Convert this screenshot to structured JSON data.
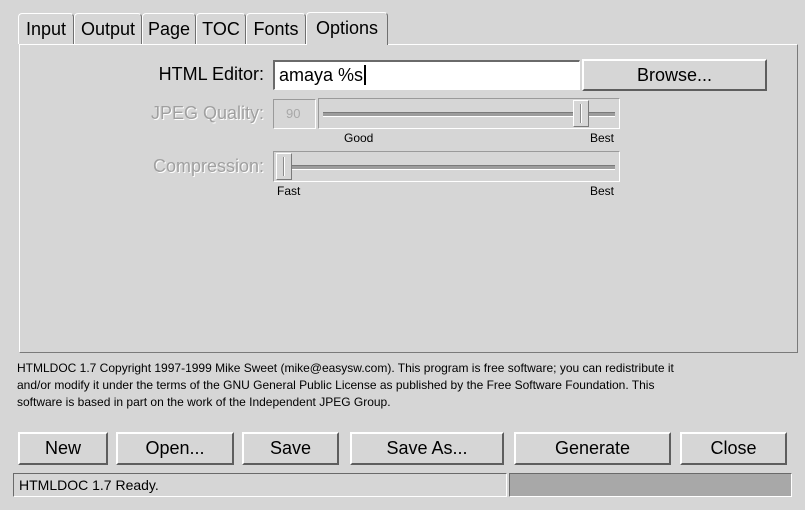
{
  "tabs": [
    {
      "label": "Input"
    },
    {
      "label": "Output"
    },
    {
      "label": "Page"
    },
    {
      "label": "TOC"
    },
    {
      "label": "Fonts"
    },
    {
      "label": "Options",
      "active": true
    }
  ],
  "options": {
    "html_editor": {
      "label": "HTML Editor:",
      "value": "amaya %s",
      "browse_label": "Browse..."
    },
    "jpeg_quality": {
      "label": "JPEG Quality:",
      "value": "90",
      "slider_fraction": 0.9,
      "tick_good": "Good",
      "tick_best": "Best",
      "enabled": false
    },
    "compression": {
      "label": "Compression:",
      "slider_fraction": 0.0,
      "tick_fast": "Fast",
      "tick_best": "Best",
      "enabled": false
    }
  },
  "copyright": {
    "line1": "HTMLDOC 1.7 Copyright 1997-1999 Mike Sweet (mike@easysw.com). This program is free software; you can redistribute it",
    "line2": "and/or modify it under the terms of the GNU General Public License as published by the Free Software Foundation. This",
    "line3": "software is based in part on the work of the Independent JPEG Group."
  },
  "buttons": {
    "new": "New",
    "open": "Open...",
    "save": "Save",
    "save_as": "Save As...",
    "generate": "Generate",
    "close": "Close"
  },
  "status": {
    "text": "HTMLDOC 1.7 Ready.",
    "progress": 0
  },
  "colors": {
    "background": "#d6d6d6",
    "disabled_text": "#a0a0a0",
    "progress_well": "#a8a8a8"
  }
}
